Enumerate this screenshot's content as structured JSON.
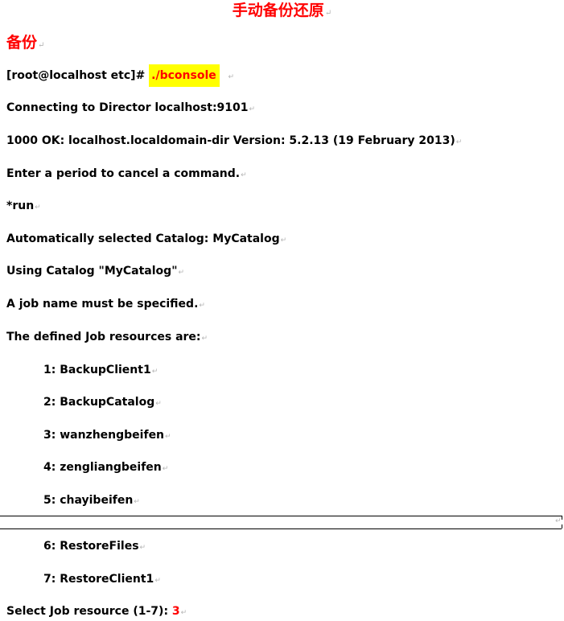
{
  "document": {
    "title": "手动备份还原",
    "section_heading": "备份",
    "prompt": "[root@localhost etc]# ",
    "command": "./bconsole",
    "paragraph_mark": "↵",
    "lines": [
      "Connecting to Director localhost:9101",
      "1000 OK: localhost.localdomain-dir Version: 5.2.13 (19 February 2013)",
      "Enter a period to cancel a command.",
      "*run",
      "Automatically selected Catalog: MyCatalog",
      "Using Catalog \"MyCatalog\"",
      "A job name must be specified.",
      "The defined Job resources are:"
    ],
    "job_resources": [
      "1: BackupClient1",
      "2: BackupCatalog",
      "3: wanzhengbeifen",
      "4: zengliangbeifen",
      "5: chayibeifen",
      "6: RestoreFiles",
      "7: RestoreClient1"
    ],
    "select_prompt": "Select Job resource (1-7): ",
    "select_answer": "3"
  },
  "colors": {
    "accent_red": "#ff0000",
    "highlight_yellow": "#ffff00",
    "paragraph_mark_gray": "#b5b5b5"
  }
}
